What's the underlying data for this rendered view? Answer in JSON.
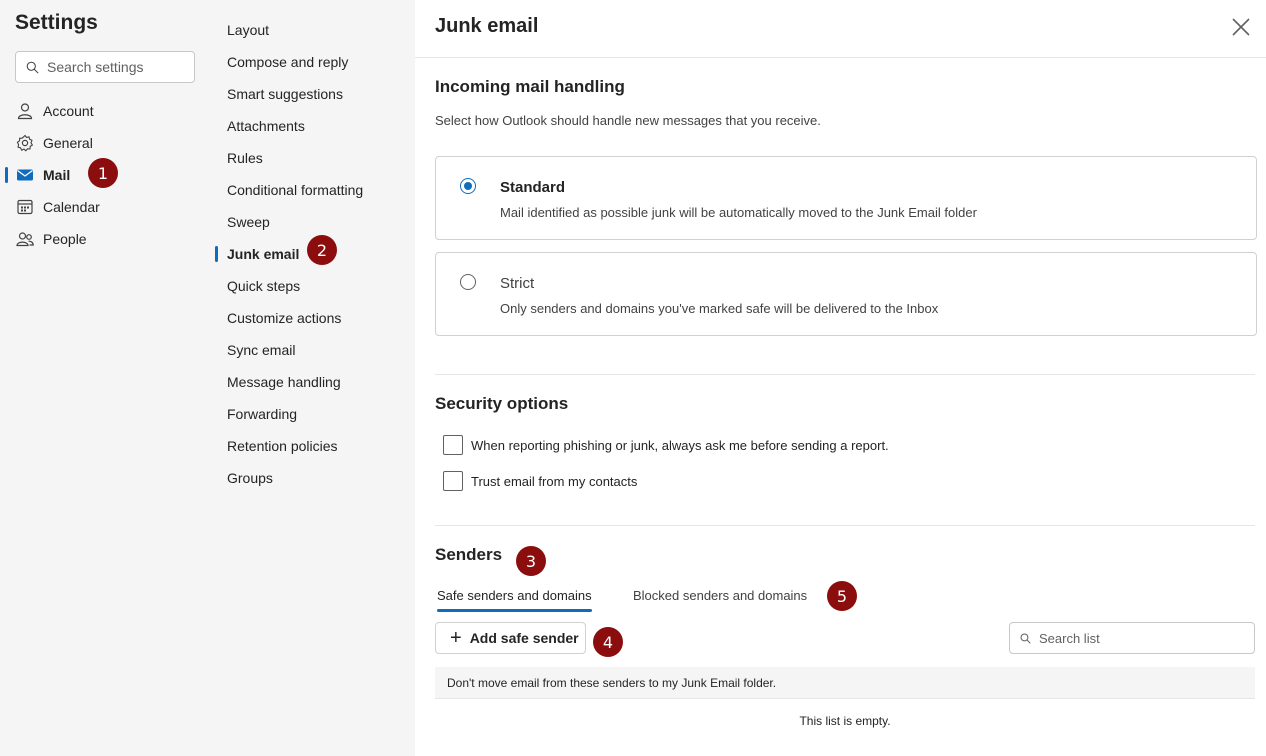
{
  "settings": {
    "title": "Settings",
    "search_placeholder": "Search settings",
    "nav": [
      {
        "label": "Account"
      },
      {
        "label": "General"
      },
      {
        "label": "Mail"
      },
      {
        "label": "Calendar"
      },
      {
        "label": "People"
      }
    ]
  },
  "mail_nav": [
    {
      "label": "Layout"
    },
    {
      "label": "Compose and reply"
    },
    {
      "label": "Smart suggestions"
    },
    {
      "label": "Attachments"
    },
    {
      "label": "Rules"
    },
    {
      "label": "Conditional formatting"
    },
    {
      "label": "Sweep"
    },
    {
      "label": "Junk email"
    },
    {
      "label": "Quick steps"
    },
    {
      "label": "Customize actions"
    },
    {
      "label": "Sync email"
    },
    {
      "label": "Message handling"
    },
    {
      "label": "Forwarding"
    },
    {
      "label": "Retention policies"
    },
    {
      "label": "Groups"
    }
  ],
  "badges": [
    "1",
    "2",
    "3",
    "4",
    "5"
  ],
  "main": {
    "title": "Junk email",
    "incoming": {
      "title": "Incoming mail handling",
      "description": "Select how Outlook should handle new messages that you receive.",
      "options": [
        {
          "title": "Standard",
          "desc": "Mail identified as possible junk will be automatically moved to the Junk Email folder",
          "selected": true
        },
        {
          "title": "Strict",
          "desc": "Only senders and domains you've marked safe will be delivered to the Inbox",
          "selected": false
        }
      ]
    },
    "security": {
      "title": "Security options",
      "options": [
        "When reporting phishing or junk, always ask me before sending a report.",
        "Trust email from my contacts"
      ]
    },
    "senders": {
      "title": "Senders",
      "tabs": [
        "Safe senders and domains",
        "Blocked senders and domains"
      ],
      "add_label": "Add safe sender",
      "search_placeholder": "Search list",
      "list_header": "Don't move email from these senders to my Junk Email folder.",
      "empty_text": "This list is empty."
    }
  },
  "colors": {
    "accent": "#0f6cbd",
    "badge": "#8b0d0d",
    "panel": "#f5f5f5"
  }
}
